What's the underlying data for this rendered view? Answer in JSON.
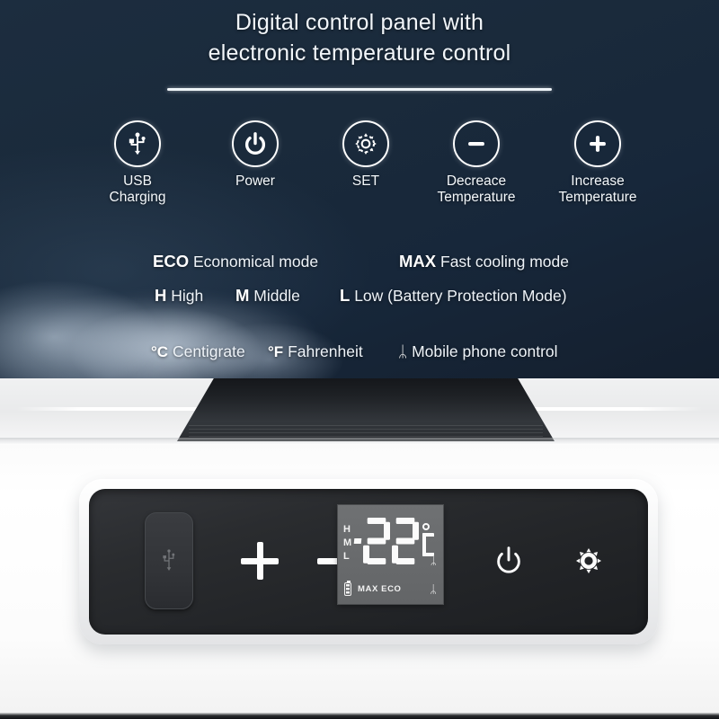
{
  "header": {
    "title_line1": "Digital control panel with",
    "title_line2": "electronic temperature control"
  },
  "features": [
    {
      "icon": "usb-icon",
      "label": "USB\nCharging"
    },
    {
      "icon": "power-icon",
      "label": "Power"
    },
    {
      "icon": "gear-icon",
      "label": "SET"
    },
    {
      "icon": "minus-icon",
      "label": "Decreace\nTemperature"
    },
    {
      "icon": "plus-icon",
      "label": "Increase\nTemperature"
    }
  ],
  "legend": {
    "row1": [
      {
        "key": "ECO",
        "text": "Economical mode"
      },
      {
        "key": "MAX",
        "text": "Fast cooling mode"
      }
    ],
    "row2": [
      {
        "key": "H",
        "text": "High"
      },
      {
        "key": "M",
        "text": "Middle"
      },
      {
        "key": "L",
        "text": "Low (Battery Protection Mode)"
      }
    ],
    "row3": [
      {
        "key": "°C",
        "text": "Centigrate"
      },
      {
        "key": "°F",
        "text": "Fahrenheit"
      },
      {
        "key": "ᛦ",
        "text": "Mobile phone  control",
        "icon": "bluetooth-icon"
      }
    ]
  },
  "device": {
    "usb_port_label": "usb-port-cover",
    "increase_symbol": "+",
    "decrease_symbol": "−",
    "display": {
      "sign": "-",
      "temperature": "22",
      "unit": "°C",
      "levels": [
        "H",
        "M",
        "L"
      ],
      "battery": "battery-icon",
      "modes": "MAX  ECO",
      "bluetooth_mid": "ᛦ",
      "bluetooth_bottom": "ᛦ"
    },
    "power_button": "power-button",
    "set_button": "set-button"
  },
  "colors": {
    "panel_bg_dark": "#17273a",
    "accent_white": "#ffffff",
    "lcd_bg": "#6b6d6f",
    "device_black": "#232528",
    "device_white": "#fbfbfb"
  }
}
